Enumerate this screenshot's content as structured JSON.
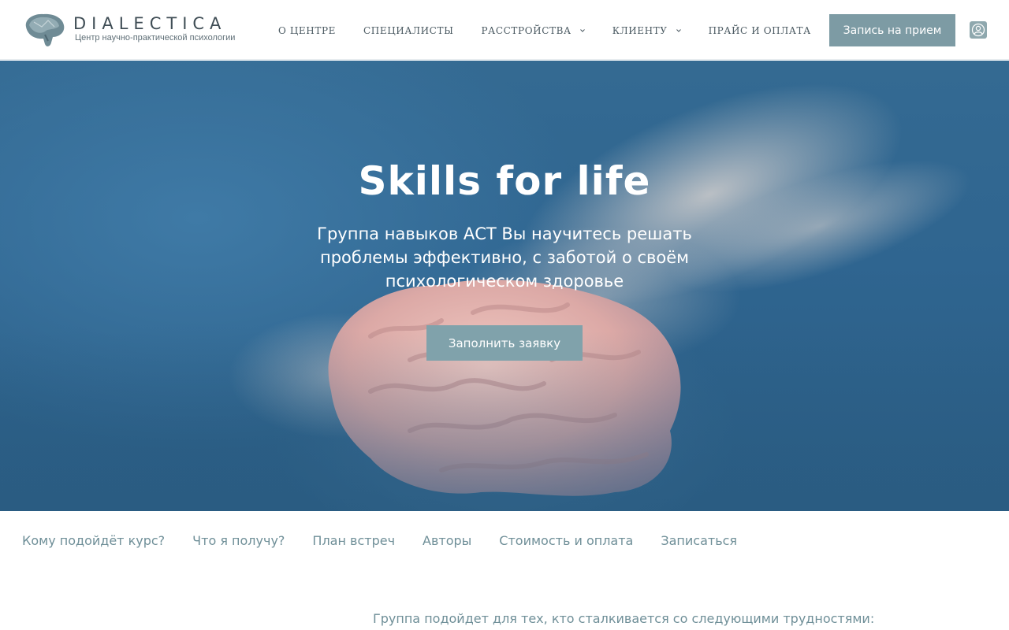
{
  "header": {
    "logo_title": "DIALECTICA",
    "logo_subtitle": "Центр научно-практической психологии",
    "nav": [
      {
        "label": "О ЦЕНТРЕ",
        "has_dropdown": false
      },
      {
        "label": "СПЕЦИАЛИСТЫ",
        "has_dropdown": false
      },
      {
        "label": "РАССТРОЙСТВА",
        "has_dropdown": true
      },
      {
        "label": "КЛИЕНТУ",
        "has_dropdown": true
      },
      {
        "label": "ПРАЙС И ОПЛАТА",
        "has_dropdown": false
      }
    ],
    "appointment_button": "Запись на прием",
    "account_icon": "user-circle-icon"
  },
  "hero": {
    "title": "Skills for life",
    "subtitle": "Группа навыков АСТ Вы научитесь решать проблемы эффективно, с заботой о своём психологическом здоровье",
    "apply_button": "Заполнить заявку",
    "image": "brain-dust-image"
  },
  "section_nav": [
    "Кому подойдёт курс?",
    "Что я получу?",
    "План встреч",
    "Авторы",
    "Стоимость и оплата",
    "Записаться"
  ],
  "lead_text": "Группа подойдет для тех, кто сталкивается со следующими трудностями:",
  "colors": {
    "accent": "#7d9ba4",
    "hero_blue": "#2f6590",
    "link": "#6f8f98",
    "text_dark": "#3f4d55"
  }
}
